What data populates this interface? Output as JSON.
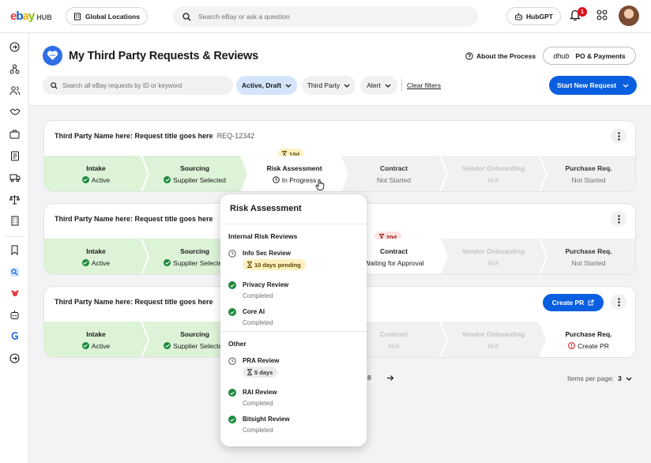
{
  "brand": {
    "ebay_e": "e",
    "ebay_b": "b",
    "ebay_a": "a",
    "ebay_y": "y",
    "hub": "HUB"
  },
  "topbar": {
    "locations_label": "Global Locations",
    "search_placeholder": "Search eBay or ask a question",
    "hubgpt_label": "HubGPT",
    "notification_count": "1"
  },
  "page": {
    "title": "My Third Party Requests & Reviews",
    "about_label": "About the Process",
    "po_brand": "dhub",
    "po_label": "PO & Payments"
  },
  "filters": {
    "search_placeholder": "Search all eBay requests by ID or keyword",
    "status_pill": "Active, Draft",
    "third_party_pill": "Third Party",
    "alert_pill": "Alert",
    "clear_label": "Clear filters",
    "start_label": "Start New Request"
  },
  "cards": [
    {
      "title": "Third Party Name here: Request title goes here",
      "id": "REQ-12342",
      "stages": [
        {
          "name": "Intake",
          "status": "Active"
        },
        {
          "name": "Sourcing",
          "status": "Supplier Selected"
        },
        {
          "name": "Risk Assessment",
          "status": "In Progress",
          "badge": "10d"
        },
        {
          "name": "Contract",
          "status": "Not Started"
        },
        {
          "name": "Vendor Onboarding",
          "status": "N/A"
        },
        {
          "name": "Purchase Req.",
          "status": "Not Started"
        }
      ]
    },
    {
      "title": "Third Party Name here: Request title goes here",
      "stages": [
        {
          "name": "Intake",
          "status": "Active"
        },
        {
          "name": "Sourcing",
          "status": "Supplier Selected"
        },
        {
          "name": "Contract",
          "status": "Waiting for Approval",
          "badge": "20d"
        },
        {
          "name": "Vendor Onboarding",
          "status": "N/A"
        },
        {
          "name": "Purchase Req.",
          "status": "Not Started"
        }
      ]
    },
    {
      "title": "Third Party Name here: Request title goes here",
      "create_pr_label": "Create PR",
      "stages": [
        {
          "name": "Intake",
          "status": "Active"
        },
        {
          "name": "Sourcing",
          "status": "Supplier Selected"
        },
        {
          "name": "Contract",
          "status": "N/A"
        },
        {
          "name": "Vendor Onboarding",
          "status": "N/A"
        },
        {
          "name": "Purchase Req.",
          "status": "Create PR"
        }
      ]
    }
  ],
  "pagination": {
    "page_number": "8",
    "items_per_page_label": "Items per page:",
    "items_per_page_value": "3"
  },
  "popover": {
    "title": "Risk Assessment",
    "section_internal": "Internal Risk Reviews",
    "section_other": "Other",
    "items": [
      {
        "name": "Info Sec Review",
        "status": "10 days pending"
      },
      {
        "name": "Privacy Review",
        "status": "Completed"
      },
      {
        "name": "Core AI",
        "status": "Completed"
      },
      {
        "name": "PRA Review",
        "status": "5 days"
      },
      {
        "name": "RAI Review",
        "status": "Completed"
      },
      {
        "name": "Bitsight Review",
        "status": "Completed"
      }
    ]
  },
  "colors": {
    "primary_blue": "#0a5fe0",
    "stage_complete": "#ddf3d8",
    "success_green": "#1a8a3c",
    "pending_yellow": "#fdf0c0",
    "overdue_red": "#fde1e1",
    "error_red": "#d42020"
  },
  "icons": [
    "building-icon",
    "search-icon",
    "robot-icon",
    "bell-icon",
    "apps-grid-icon",
    "question-circle-icon",
    "chevron-down-icon",
    "hourglass-icon",
    "check-circle-icon",
    "clock-icon",
    "external-link-icon",
    "kebab-icon",
    "arrow-right-icon",
    "alert-circle-icon",
    "cursor-hand-icon"
  ]
}
